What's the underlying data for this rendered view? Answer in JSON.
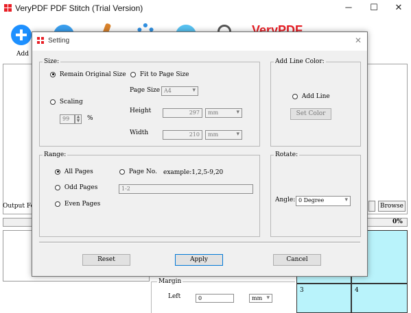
{
  "app": {
    "title": "VeryPDF PDF Stitch (Trial Version)",
    "brand": "VeryPDF",
    "add_label": "Add",
    "output_label": "Output Fo",
    "browse_label": "Browse",
    "progress_text": "0%",
    "progress_value": 0,
    "preview_cells": [
      "3",
      "4"
    ],
    "margin_legend": "Margin",
    "margin_left_label": "Left",
    "margin_left_value": "0",
    "margin_unit": "mm"
  },
  "dialog": {
    "title": "Setting",
    "size": {
      "legend": "Size:",
      "remain_original": "Remain Original Size",
      "fit_to_page": "Fit to Page Size",
      "page_size_label": "Page Size",
      "page_size_value": "A4",
      "scaling_label": "Scaling",
      "scaling_value": "99",
      "percent": "%",
      "height_label": "Height",
      "height_value": "297",
      "width_label": "Width",
      "width_value": "210",
      "unit": "mm"
    },
    "line_color": {
      "legend": "Add Line Color:",
      "add_line": "Add Line",
      "set_color": "Set Color"
    },
    "range": {
      "legend": "Range:",
      "all_pages": "All Pages",
      "page_no": "Page No.",
      "example": "example:1,2,5-9,20",
      "odd_pages": "Odd Pages",
      "page_no_value": "1-2",
      "even_pages": "Even Pages"
    },
    "rotate": {
      "legend": "Rotate:",
      "angle_label": "Angle:",
      "angle_value": "0 Degree"
    },
    "buttons": {
      "reset": "Reset",
      "apply": "Apply",
      "cancel": "Cancel"
    }
  },
  "colors": {
    "accent": "#0078d7",
    "brand_red": "#e81e25",
    "preview_cyan": "#b9f3fb"
  }
}
